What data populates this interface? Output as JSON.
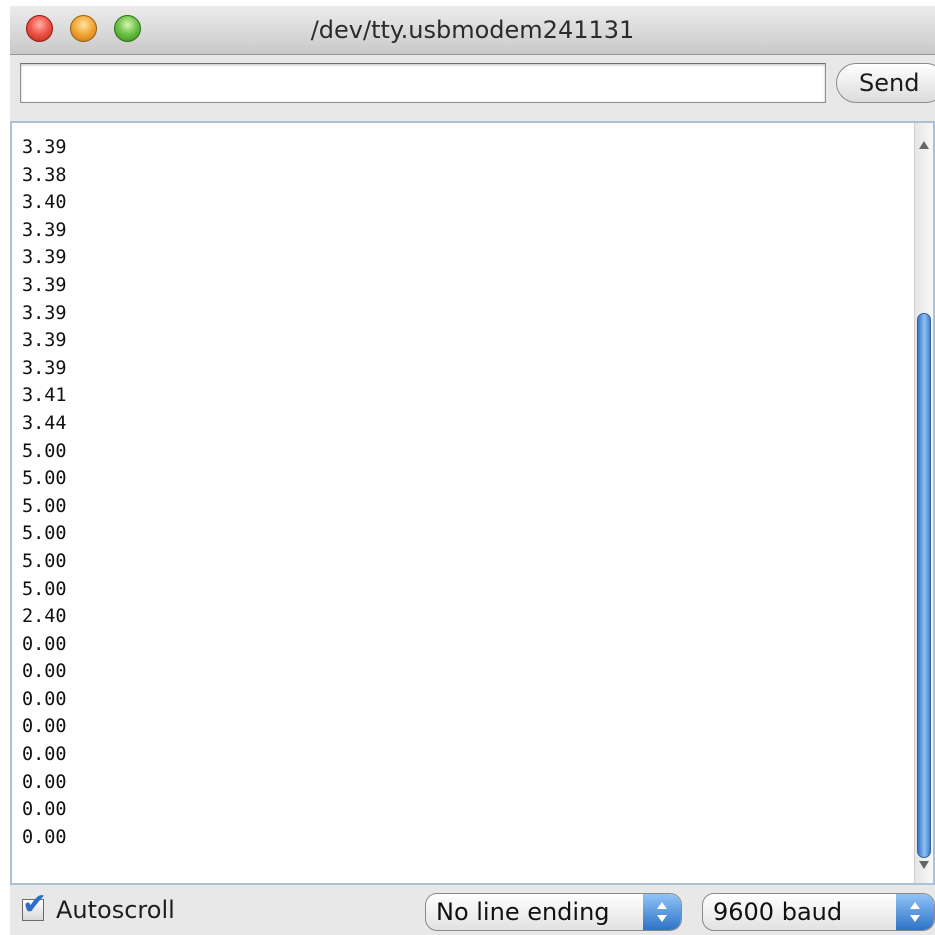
{
  "window": {
    "title": "/dev/tty.usbmodem241131"
  },
  "toolbar": {
    "input_value": "",
    "send_label": "Send"
  },
  "output": {
    "lines": [
      "3.39",
      "3.38",
      "3.40",
      "3.39",
      "3.39",
      "3.39",
      "3.39",
      "3.39",
      "3.39",
      "3.41",
      "3.44",
      "5.00",
      "5.00",
      "5.00",
      "5.00",
      "5.00",
      "5.00",
      "2.40",
      "0.00",
      "0.00",
      "0.00",
      "0.00",
      "0.00",
      "0.00",
      "0.00",
      "0.00"
    ]
  },
  "status": {
    "autoscroll_label": "Autoscroll",
    "autoscroll_checked": true,
    "line_ending": "No line ending",
    "baud": "9600 baud"
  },
  "colors": {
    "accent": "#3a78c9",
    "close": "#f2574c",
    "minimize": "#f5a93a",
    "zoom": "#71c44b"
  },
  "icons": {
    "check": "checkmark-icon",
    "stepper": "up-down-chevron-icon"
  }
}
